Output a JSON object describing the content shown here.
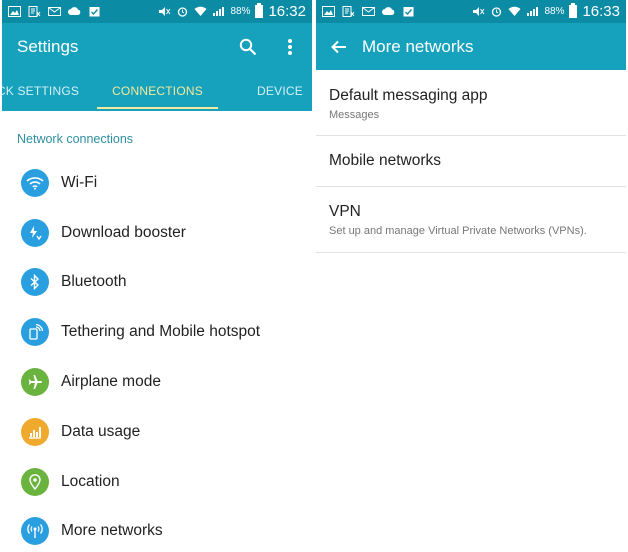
{
  "left": {
    "status": {
      "battery": "88%",
      "time": "16:32"
    },
    "appbar": {
      "title": "Settings"
    },
    "tabs": [
      {
        "label": "QUICK SETTINGS"
      },
      {
        "label": "CONNECTIONS"
      },
      {
        "label": "DEVICE"
      }
    ],
    "section_header": "Network connections",
    "items": [
      {
        "label": "Wi-Fi",
        "icon": "wifi-icon",
        "color": "#2a9fe0"
      },
      {
        "label": "Download booster",
        "icon": "download-booster-icon",
        "color": "#2a9fe0"
      },
      {
        "label": "Bluetooth",
        "icon": "bluetooth-icon",
        "color": "#2a9fe0"
      },
      {
        "label": "Tethering and Mobile hotspot",
        "icon": "tethering-icon",
        "color": "#2a9fe0"
      },
      {
        "label": "Airplane mode",
        "icon": "airplane-icon",
        "color": "#6ab33e"
      },
      {
        "label": "Data usage",
        "icon": "data-usage-icon",
        "color": "#efa92d"
      },
      {
        "label": "Location",
        "icon": "location-icon",
        "color": "#6ab33e"
      },
      {
        "label": "More networks",
        "icon": "more-networks-icon",
        "color": "#2a9fe0"
      }
    ]
  },
  "right": {
    "status": {
      "battery": "88%",
      "time": "16:33"
    },
    "appbar": {
      "title": "More networks"
    },
    "items": [
      {
        "title": "Default messaging app",
        "subtitle": "Messages"
      },
      {
        "title": "Mobile networks",
        "subtitle": ""
      },
      {
        "title": "VPN",
        "subtitle": "Set up and manage Virtual Private Networks (VPNs)."
      }
    ]
  },
  "colors": {
    "status_bar": "#0c8ba4",
    "app_bar": "#16a2bd",
    "tab_active": "#f3e99a",
    "section_header": "#2f8fa0"
  }
}
